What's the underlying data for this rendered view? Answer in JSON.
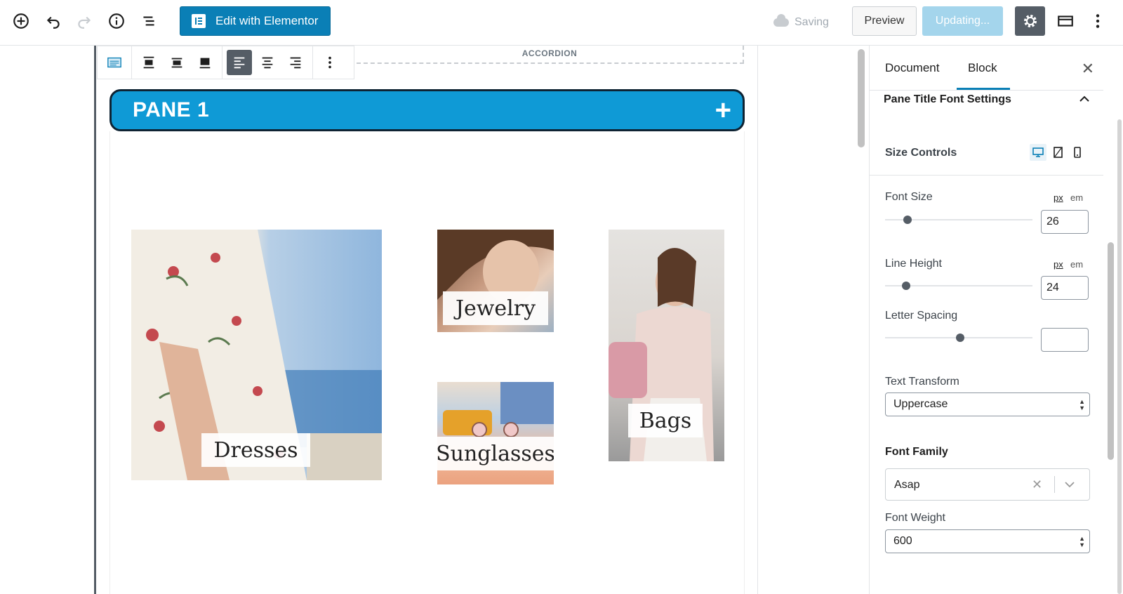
{
  "toolbar": {
    "edit_button_label": "Edit with Elementor",
    "saving_label": "Saving",
    "preview_label": "Preview",
    "updating_label": "Updating..."
  },
  "block": {
    "accordion_label": "ACCORDION",
    "pane_title": "PANE 1",
    "pane_toggle": "+"
  },
  "tiles": [
    {
      "label": "Dresses",
      "icon": "dress-photo"
    },
    {
      "label": "Jewelry",
      "icon": "jewelry-photo"
    },
    {
      "label": "Sunglasses",
      "icon": "sunglasses-photo"
    },
    {
      "label": "Bags",
      "icon": "bags-photo"
    }
  ],
  "sidebar": {
    "tabs": [
      "Document",
      "Block"
    ],
    "active_tab": "Block",
    "close": "✕",
    "section_title": "Pane Title Font Settings",
    "size_controls": "Size Controls",
    "font_size": {
      "label": "Font Size",
      "unit_px": "px",
      "unit_em": "em",
      "value": "26"
    },
    "line_height": {
      "label": "Line Height",
      "unit_px": "px",
      "unit_em": "em",
      "value": "24"
    },
    "letter_spacing": {
      "label": "Letter Spacing",
      "value": ""
    },
    "text_transform": {
      "label": "Text Transform",
      "value": "Uppercase"
    },
    "font_family": {
      "label": "Font Family",
      "value": "Asap"
    },
    "font_weight": {
      "label": "Font Weight",
      "value": "600"
    }
  },
  "colors": {
    "accent": "#0a7fb6",
    "pane_bg": "#0f9ad6",
    "pane_border": "#0e2333"
  }
}
